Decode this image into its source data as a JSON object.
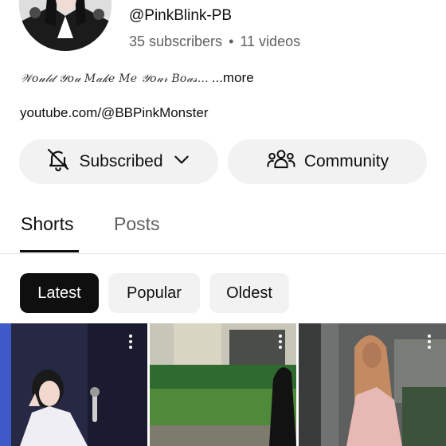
{
  "channel": {
    "handle": "@PinkBlink-PB",
    "subscribers": "35 subscribers",
    "separator": "•",
    "videos": "11 videos",
    "description": "𝒲𝑜𝓊𝓁𝒹 𝒴𝑜𝓊 𝑀𝒶𝓀𝑒 𝑀𝑒 𝒴𝑜𝓊𝓇 𝐵𝑜𝒶𝓈...",
    "more_label": "...more",
    "link": "youtube.com/@BBPinkMonster"
  },
  "actions": {
    "subscribed_label": "Subscribed",
    "community_label": "Community"
  },
  "tabs": [
    {
      "label": "Shorts",
      "active": true
    },
    {
      "label": "Posts",
      "active": false
    }
  ],
  "filters": [
    {
      "label": "Latest",
      "active": true
    },
    {
      "label": "Popular",
      "active": false
    },
    {
      "label": "Oldest",
      "active": false
    }
  ],
  "icons": {
    "subscribed": "bell-off-icon",
    "dropdown": "chevron-down-icon",
    "community": "people-icon",
    "menu": "more-vertical-icon"
  },
  "colors": {
    "text": "#0f0f0f",
    "secondary_text": "#606060",
    "button_bg": "#f2f2f2",
    "active_chip_bg": "#0f0f0f"
  }
}
